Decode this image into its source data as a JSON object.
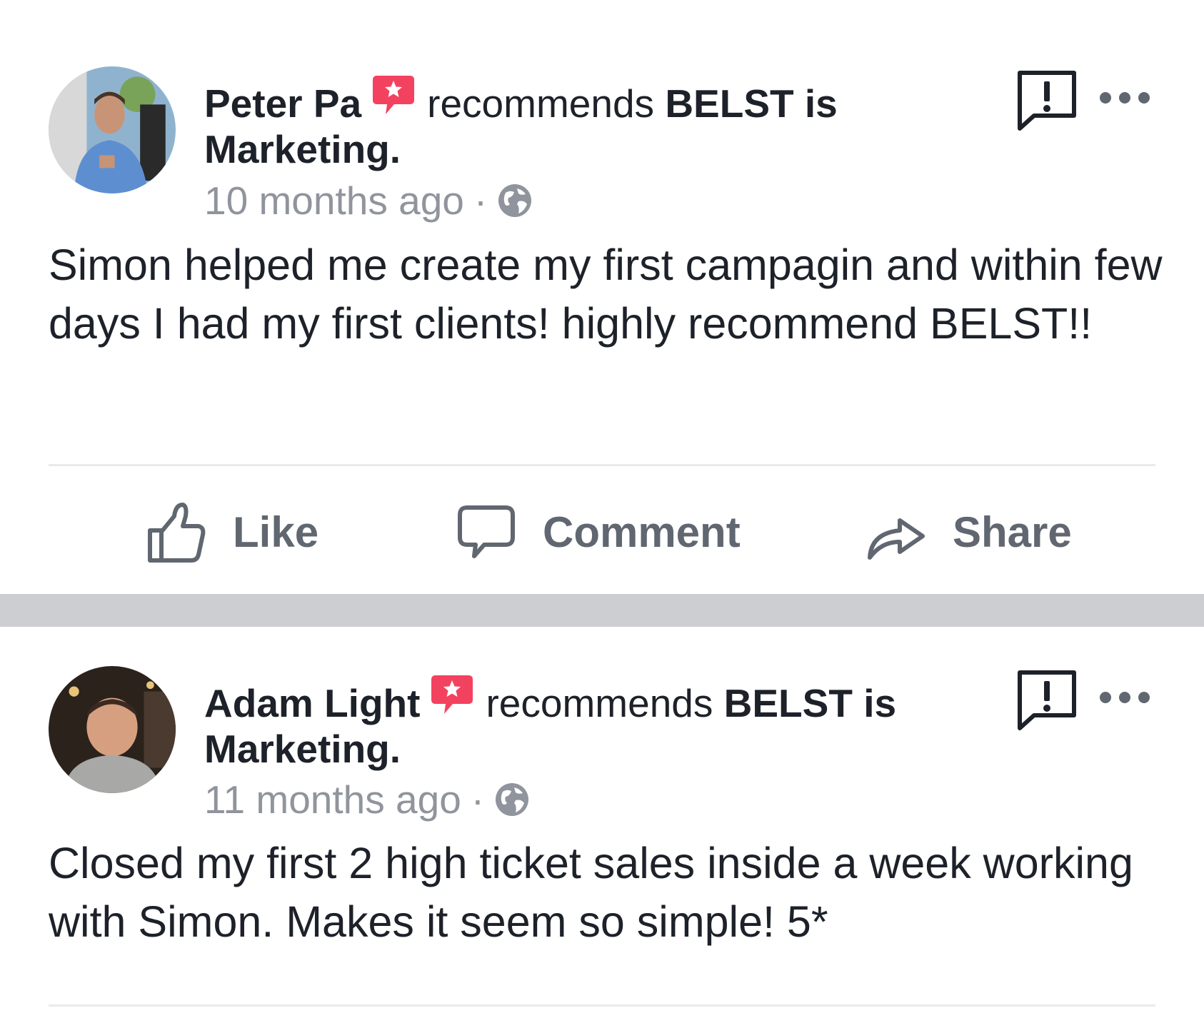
{
  "posts": [
    {
      "author": "Peter Pa",
      "action_text": "recommends",
      "page_name_line1": "BELST is",
      "page_name_line2": "Marketing.",
      "time": "10 months ago",
      "separator": "·",
      "body": "Simon helped me create my first campagin and within few days I had my first clients! highly recommend BELST!!",
      "icons": {
        "recommend": "recommendation-star-icon",
        "privacy": "globe-icon",
        "report": "report-icon",
        "more": "more-options-icon"
      }
    },
    {
      "author": "Adam Light",
      "action_text": "recommends",
      "page_name_line1": "BELST is",
      "page_name_line2": "Marketing.",
      "time": "11 months ago",
      "separator": "·",
      "body": "Closed my first 2 high ticket sales inside a week working with Simon. Makes it seem so simple! 5*",
      "icons": {
        "recommend": "recommendation-star-icon",
        "privacy": "globe-icon",
        "report": "report-icon",
        "more": "more-options-icon"
      }
    }
  ],
  "actions": {
    "like": "Like",
    "comment": "Comment",
    "share": "Share"
  },
  "colors": {
    "text": "#1d2129",
    "meta": "#90949c",
    "action": "#606770",
    "badge": "#f3425f",
    "separator": "#cdced2"
  }
}
